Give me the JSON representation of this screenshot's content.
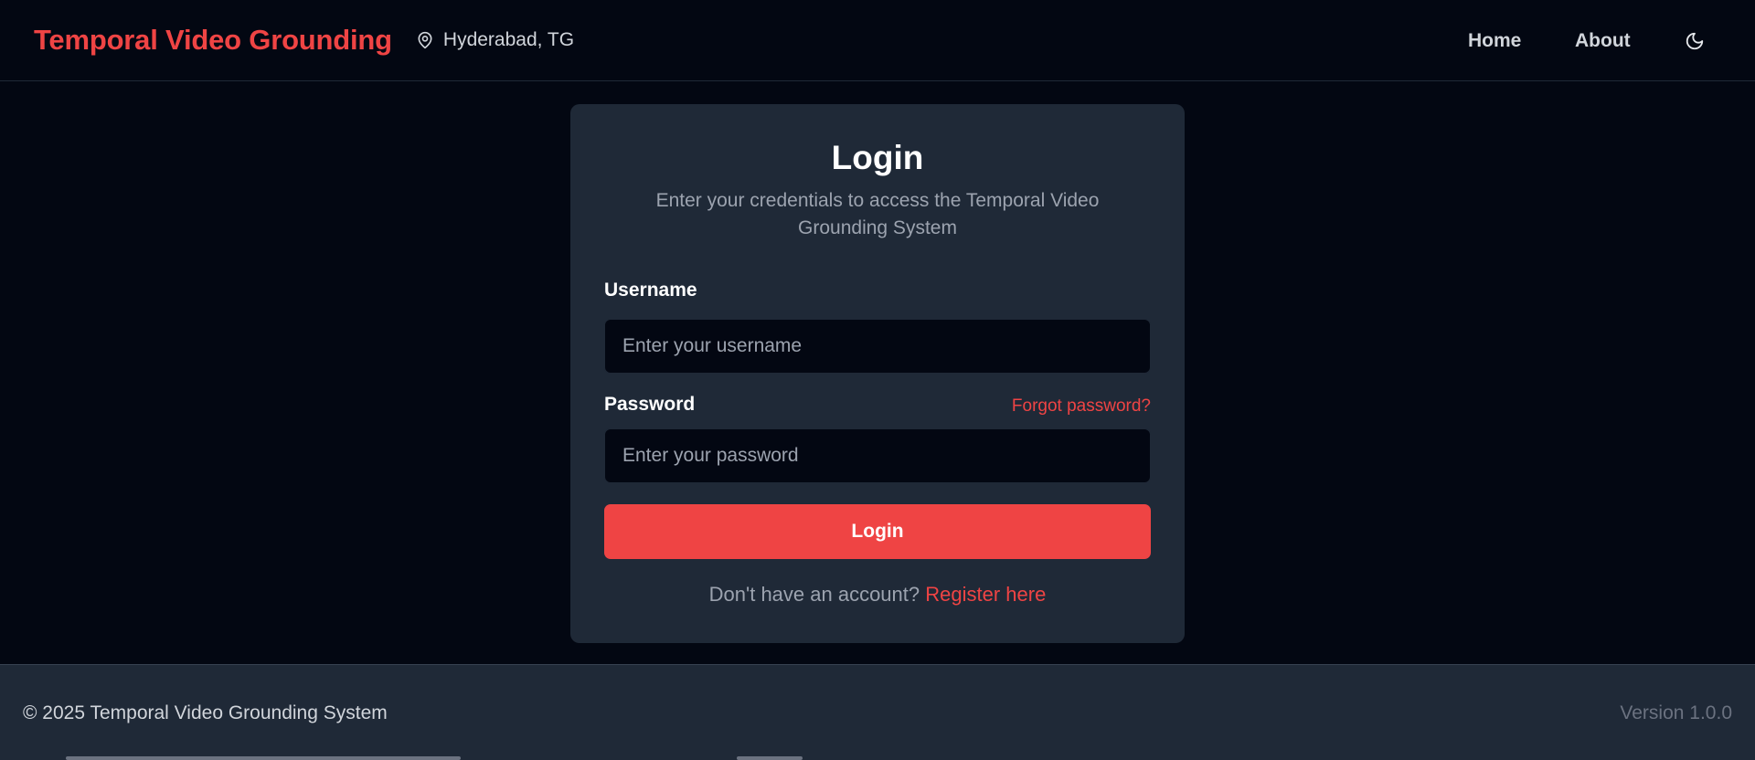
{
  "header": {
    "brand": "Temporal Video Grounding",
    "location": "Hyderabad, TG",
    "nav": {
      "home": "Home",
      "about": "About"
    },
    "theme_icon": "moon-icon"
  },
  "login": {
    "title": "Login",
    "subtitle": "Enter your credentials to access the Temporal Video Grounding System",
    "username_label": "Username",
    "username_placeholder": "Enter your username",
    "username_value": "",
    "password_label": "Password",
    "password_placeholder": "Enter your password",
    "password_value": "",
    "forgot_label": "Forgot password?",
    "submit_label": "Login",
    "register_prompt": "Don't have an account?",
    "register_link": "Register here"
  },
  "footer": {
    "copyright": "© 2025 Temporal Video Grounding System",
    "version": "Version 1.0.0"
  },
  "colors": {
    "accent": "#ef4444",
    "background": "#030712",
    "card": "#1f2937"
  }
}
